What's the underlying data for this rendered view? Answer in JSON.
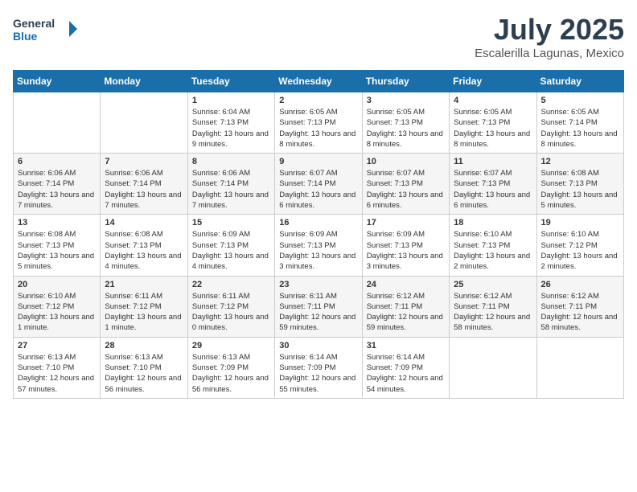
{
  "header": {
    "logo_line1": "General",
    "logo_line2": "Blue",
    "month": "July 2025",
    "location": "Escalerilla Lagunas, Mexico"
  },
  "days_of_week": [
    "Sunday",
    "Monday",
    "Tuesday",
    "Wednesday",
    "Thursday",
    "Friday",
    "Saturday"
  ],
  "weeks": [
    [
      {
        "day": "",
        "info": ""
      },
      {
        "day": "",
        "info": ""
      },
      {
        "day": "1",
        "info": "Sunrise: 6:04 AM\nSunset: 7:13 PM\nDaylight: 13 hours and 9 minutes."
      },
      {
        "day": "2",
        "info": "Sunrise: 6:05 AM\nSunset: 7:13 PM\nDaylight: 13 hours and 8 minutes."
      },
      {
        "day": "3",
        "info": "Sunrise: 6:05 AM\nSunset: 7:13 PM\nDaylight: 13 hours and 8 minutes."
      },
      {
        "day": "4",
        "info": "Sunrise: 6:05 AM\nSunset: 7:13 PM\nDaylight: 13 hours and 8 minutes."
      },
      {
        "day": "5",
        "info": "Sunrise: 6:05 AM\nSunset: 7:14 PM\nDaylight: 13 hours and 8 minutes."
      }
    ],
    [
      {
        "day": "6",
        "info": "Sunrise: 6:06 AM\nSunset: 7:14 PM\nDaylight: 13 hours and 7 minutes."
      },
      {
        "day": "7",
        "info": "Sunrise: 6:06 AM\nSunset: 7:14 PM\nDaylight: 13 hours and 7 minutes."
      },
      {
        "day": "8",
        "info": "Sunrise: 6:06 AM\nSunset: 7:14 PM\nDaylight: 13 hours and 7 minutes."
      },
      {
        "day": "9",
        "info": "Sunrise: 6:07 AM\nSunset: 7:14 PM\nDaylight: 13 hours and 6 minutes."
      },
      {
        "day": "10",
        "info": "Sunrise: 6:07 AM\nSunset: 7:13 PM\nDaylight: 13 hours and 6 minutes."
      },
      {
        "day": "11",
        "info": "Sunrise: 6:07 AM\nSunset: 7:13 PM\nDaylight: 13 hours and 6 minutes."
      },
      {
        "day": "12",
        "info": "Sunrise: 6:08 AM\nSunset: 7:13 PM\nDaylight: 13 hours and 5 minutes."
      }
    ],
    [
      {
        "day": "13",
        "info": "Sunrise: 6:08 AM\nSunset: 7:13 PM\nDaylight: 13 hours and 5 minutes."
      },
      {
        "day": "14",
        "info": "Sunrise: 6:08 AM\nSunset: 7:13 PM\nDaylight: 13 hours and 4 minutes."
      },
      {
        "day": "15",
        "info": "Sunrise: 6:09 AM\nSunset: 7:13 PM\nDaylight: 13 hours and 4 minutes."
      },
      {
        "day": "16",
        "info": "Sunrise: 6:09 AM\nSunset: 7:13 PM\nDaylight: 13 hours and 3 minutes."
      },
      {
        "day": "17",
        "info": "Sunrise: 6:09 AM\nSunset: 7:13 PM\nDaylight: 13 hours and 3 minutes."
      },
      {
        "day": "18",
        "info": "Sunrise: 6:10 AM\nSunset: 7:13 PM\nDaylight: 13 hours and 2 minutes."
      },
      {
        "day": "19",
        "info": "Sunrise: 6:10 AM\nSunset: 7:12 PM\nDaylight: 13 hours and 2 minutes."
      }
    ],
    [
      {
        "day": "20",
        "info": "Sunrise: 6:10 AM\nSunset: 7:12 PM\nDaylight: 13 hours and 1 minute."
      },
      {
        "day": "21",
        "info": "Sunrise: 6:11 AM\nSunset: 7:12 PM\nDaylight: 13 hours and 1 minute."
      },
      {
        "day": "22",
        "info": "Sunrise: 6:11 AM\nSunset: 7:12 PM\nDaylight: 13 hours and 0 minutes."
      },
      {
        "day": "23",
        "info": "Sunrise: 6:11 AM\nSunset: 7:11 PM\nDaylight: 12 hours and 59 minutes."
      },
      {
        "day": "24",
        "info": "Sunrise: 6:12 AM\nSunset: 7:11 PM\nDaylight: 12 hours and 59 minutes."
      },
      {
        "day": "25",
        "info": "Sunrise: 6:12 AM\nSunset: 7:11 PM\nDaylight: 12 hours and 58 minutes."
      },
      {
        "day": "26",
        "info": "Sunrise: 6:12 AM\nSunset: 7:11 PM\nDaylight: 12 hours and 58 minutes."
      }
    ],
    [
      {
        "day": "27",
        "info": "Sunrise: 6:13 AM\nSunset: 7:10 PM\nDaylight: 12 hours and 57 minutes."
      },
      {
        "day": "28",
        "info": "Sunrise: 6:13 AM\nSunset: 7:10 PM\nDaylight: 12 hours and 56 minutes."
      },
      {
        "day": "29",
        "info": "Sunrise: 6:13 AM\nSunset: 7:09 PM\nDaylight: 12 hours and 56 minutes."
      },
      {
        "day": "30",
        "info": "Sunrise: 6:14 AM\nSunset: 7:09 PM\nDaylight: 12 hours and 55 minutes."
      },
      {
        "day": "31",
        "info": "Sunrise: 6:14 AM\nSunset: 7:09 PM\nDaylight: 12 hours and 54 minutes."
      },
      {
        "day": "",
        "info": ""
      },
      {
        "day": "",
        "info": ""
      }
    ]
  ]
}
